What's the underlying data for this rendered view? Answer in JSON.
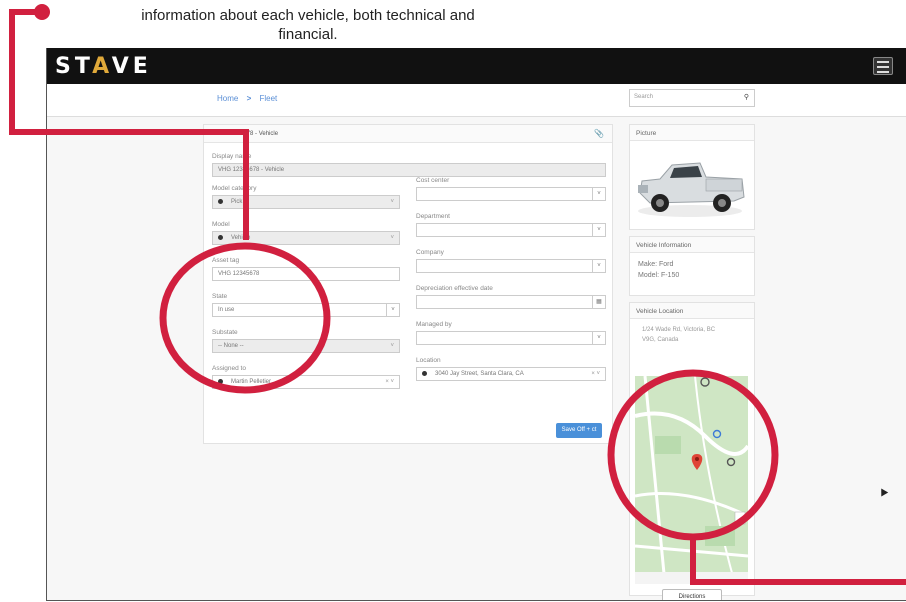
{
  "caption": {
    "line1": "information about each vehicle, both technical and",
    "line2": "financial."
  },
  "app": {
    "logo": "ST",
    "logo_mid": "A",
    "logo_end": "VE"
  },
  "breadcrumb": {
    "home": "Home",
    "sep": ">",
    "current": "Fleet"
  },
  "search": {
    "placeholder": "Search",
    "icon": "search-icon"
  },
  "form": {
    "header": "VHG 12345678 - Vehicle",
    "display_name_label": "Display name",
    "display_name_value": "VHG 12345678 - Vehicle",
    "model_category_label": "Model category",
    "model_category_value": "Pick",
    "model_label": "Model",
    "model_value": "Vehicle",
    "asset_tag_label": "Asset tag",
    "asset_tag_value": "VHG 12345678",
    "state_label": "State",
    "state_value": "In use",
    "substate_label": "Substate",
    "substate_value": "-- None --",
    "assigned_to_label": "Assigned to",
    "assigned_to_value": "Martin Pelletier",
    "cost_center_label": "Cost center",
    "department_label": "Department",
    "company_label": "Company",
    "depreciation_label": "Depreciation effective date",
    "managed_by_label": "Managed by",
    "location_label": "Location",
    "location_value": "3040 Jay Street, Santa Clara, CA",
    "save_button": "Save Off + ct"
  },
  "picture": {
    "title": "Picture"
  },
  "vehicle_info": {
    "title": "Vehicle Information",
    "make": "Make: Ford",
    "model": "Model: F-150"
  },
  "vehicle_location": {
    "title": "Vehicle Location",
    "address_line1": "1/24 Wade Rd, Victoria, BC",
    "address_line2": "V9G, Canada",
    "directions_button": "Directions"
  },
  "colors": {
    "accent": "#d1203f",
    "topbar": "#111111",
    "brand_link": "#5b8fd6",
    "save_button": "#4a90d9"
  }
}
